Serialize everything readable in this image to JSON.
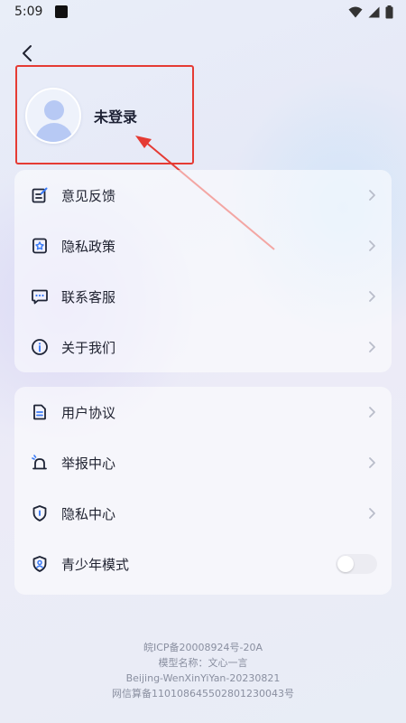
{
  "status_bar": {
    "time": "5:09"
  },
  "profile": {
    "login_status": "未登录"
  },
  "menu_group_1": [
    {
      "label": "意见反馈",
      "icon": "feedback-icon"
    },
    {
      "label": "隐私政策",
      "icon": "privacy-policy-icon"
    },
    {
      "label": "联系客服",
      "icon": "customer-service-icon"
    },
    {
      "label": "关于我们",
      "icon": "info-icon"
    }
  ],
  "menu_group_2": [
    {
      "label": "用户协议",
      "icon": "document-icon"
    },
    {
      "label": "举报中心",
      "icon": "alarm-icon"
    },
    {
      "label": "隐私中心",
      "icon": "shield-icon"
    },
    {
      "label": "青少年模式",
      "icon": "teen-shield-icon",
      "toggle_on": false
    }
  ],
  "footer": {
    "line1": "皖ICP备20008924号-20A",
    "line2": "模型名称：文心一言",
    "line3": "Beijing-WenXinYiYan-20230821",
    "line4": "网信算备110108645502801230043号"
  },
  "colors": {
    "icon": "#1e2436",
    "icon_accent": "#3b7bf6",
    "annotation": "#e53b34"
  }
}
